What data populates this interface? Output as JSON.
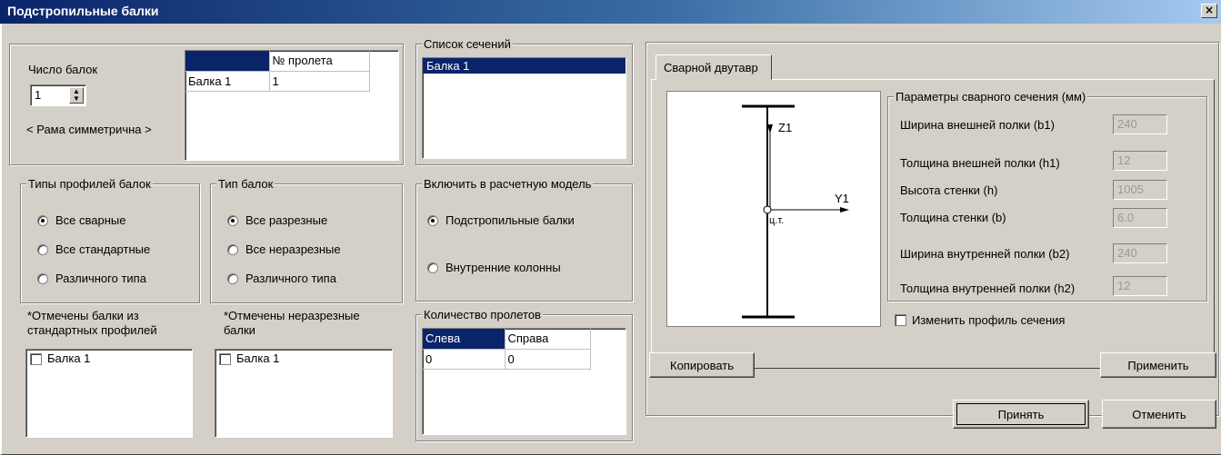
{
  "window": {
    "title": "Подстропильные балки",
    "close_glyph": "×"
  },
  "beams": {
    "count_label": "Число балок",
    "count_value": "1",
    "symmetric_label": "< Рама симметрична >",
    "table_header": [
      "",
      "№ пролета"
    ],
    "table_rows": [
      [
        "Балка 1",
        "1"
      ]
    ]
  },
  "sections": {
    "legend": "Список сечений",
    "items": [
      "Балка 1"
    ]
  },
  "profile_types": {
    "legend": "Типы профилей балок",
    "options": [
      "Все сварные",
      "Все стандартные",
      "Различного типа"
    ],
    "selected": 0,
    "note": "*Отмечены балки из стандартных профилей",
    "items": [
      "Балка 1"
    ]
  },
  "beam_types": {
    "legend": "Тип балок",
    "options": [
      "Все разрезные",
      "Все неразрезные",
      "Различного типа"
    ],
    "selected": 0,
    "note": "*Отмечены неразрезные балки",
    "items": [
      "Балка 1"
    ]
  },
  "include": {
    "legend": "Включить в расчетную модель",
    "options": [
      "Подстропильные балки",
      "Внутренние колонны"
    ],
    "selected": 0
  },
  "spans": {
    "legend": "Количество пролетов",
    "headers": [
      "Слева",
      "Справа"
    ],
    "values": [
      "0",
      "0"
    ]
  },
  "tab": {
    "label": "Сварной двутавр"
  },
  "diagram": {
    "z_label": "Z1",
    "y_label": "Y1",
    "center_label": "ц.т."
  },
  "params": {
    "legend": "Параметры сварного сечения (мм)",
    "rows": [
      {
        "label": "Ширина внешней полки (b1)",
        "value": "240"
      },
      {
        "label": "Толщина внешней полки (h1)",
        "value": "12"
      },
      {
        "label": "Высота стенки  (h)",
        "value": "1005"
      },
      {
        "label": "Толщина стенки (b)",
        "value": "6.0"
      },
      {
        "label": "Ширина внутренней полки (b2)",
        "value": "240"
      },
      {
        "label": "Толщина внутренней полки (h2)",
        "value": "12"
      }
    ]
  },
  "change_profile": "Изменить профиль сечения",
  "buttons": {
    "copy": "Копировать",
    "apply": "Применить",
    "accept": "Принять",
    "cancel": "Отменить"
  }
}
